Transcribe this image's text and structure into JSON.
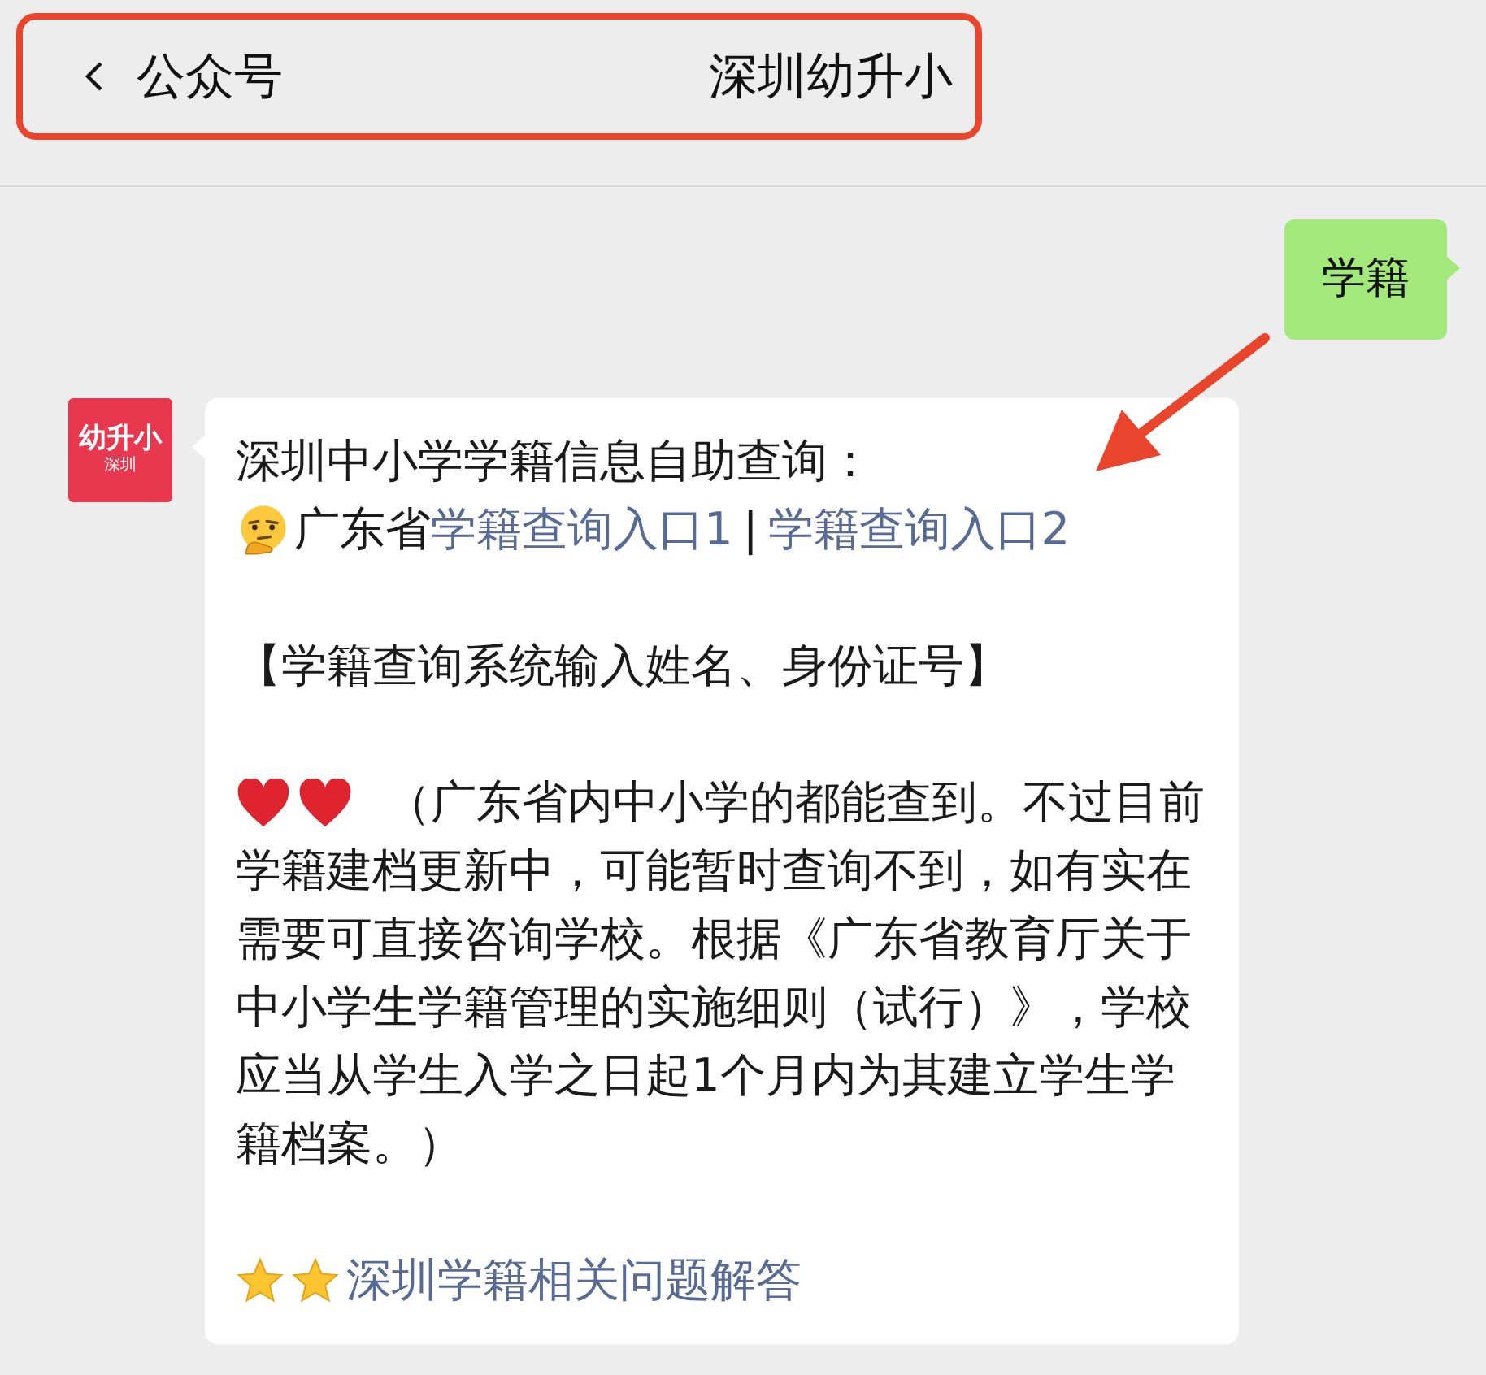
{
  "header": {
    "back_label": "公众号",
    "title": "深圳幼升小"
  },
  "messages": [
    {
      "kind": "outgoing",
      "text": "学籍"
    },
    {
      "kind": "incoming",
      "avatar": {
        "top": "幼升小",
        "bottom": "深圳"
      },
      "title": "深圳中小学学籍信息自助查询：",
      "province": "广东省",
      "links": [
        "学籍查询入口1",
        "学籍查询入口2"
      ],
      "separator": "|",
      "note": "【学籍查询系统输入姓名、身份证号】",
      "paragraph_lines": [
        "（广东省内中小学的都能查到。不过目前",
        "学籍建档更新中，可能暂时查询不到，如有实在",
        "需要可直接咨询学校。根据《广东省教育厅关于",
        "中小学生学籍管理的实施细则（试行）》，学校",
        "应当从学生入学之日起1个月内为其建立学生学",
        "籍档案。）"
      ],
      "footer_link": "深圳学籍相关问题解答"
    }
  ]
}
